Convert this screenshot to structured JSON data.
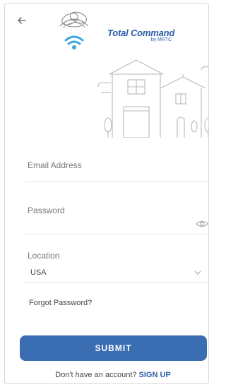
{
  "header": {
    "back_icon": "arrow-left-icon",
    "brand_title": "Total Command",
    "brand_subtitle": "by MRTC"
  },
  "form": {
    "email_label": "Email Address",
    "password_label": "Password",
    "password_icon": "eye-icon",
    "location_label": "Location",
    "location_value": "USA",
    "location_icon": "chevron-down-icon",
    "forgot_label": "Forgot Password?",
    "submit_label": "SUBMIT"
  },
  "footer": {
    "prompt": "Don't have an account?",
    "signup_label": "SIGN UP"
  },
  "colors": {
    "primary": "#3b6db3",
    "brand": "#2d5fa8"
  }
}
